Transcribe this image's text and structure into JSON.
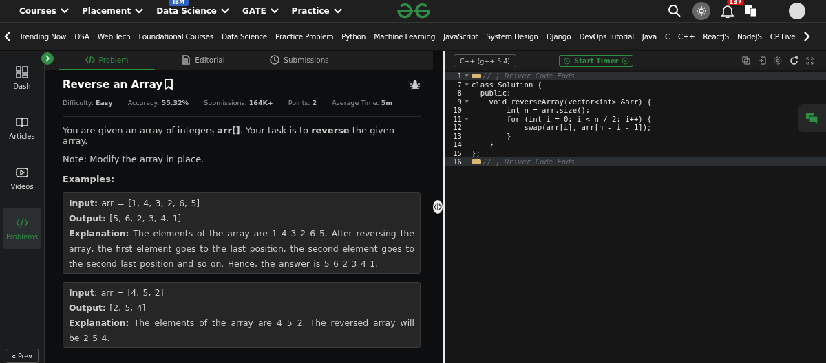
{
  "top_nav": {
    "menus": [
      {
        "label": "Courses"
      },
      {
        "label": "Placement"
      },
      {
        "label": "Data Science",
        "badge": "IBM"
      },
      {
        "label": "GATE"
      },
      {
        "label": "Practice"
      }
    ],
    "notification_count": "137"
  },
  "category_nav": [
    "Trending Now",
    "DSA",
    "Web Tech",
    "Foundational Courses",
    "Data Science",
    "Practice Problem",
    "Python",
    "Machine Learning",
    "JavaScript",
    "System Design",
    "Django",
    "DevOps Tutorial",
    "Java",
    "C",
    "C++",
    "ReactJS",
    "NodeJS",
    "CP Live"
  ],
  "sidebar": {
    "items": [
      {
        "label": "Dash",
        "selected": false
      },
      {
        "label": "Articles",
        "selected": false
      },
      {
        "label": "Videos",
        "selected": false
      },
      {
        "label": "Problems",
        "selected": true
      }
    ],
    "prev_button": "« Prev"
  },
  "tabs": [
    {
      "label": "Problem",
      "selected": true
    },
    {
      "label": "Editorial",
      "selected": false
    },
    {
      "label": "Submissions",
      "selected": false
    }
  ],
  "problem": {
    "title": "Reverse an Array",
    "meta": [
      "Difficulty: **Easy**",
      "Accuracy: **55.32%**",
      "Submissions: **164K+**",
      "Points: **2**",
      "Average Time: **5m**"
    ],
    "statement": "You are given an array of integers **arr[]**. Your task is to **reverse** the given array.",
    "note": "Note: Modify the array in place.",
    "examples_heading": "Examples:",
    "examples": [
      [
        "**Input:** arr = [1, 4, 3, 2, 6, 5]",
        "**Output:** [5, 6, 2, 3, 4, 1]",
        "**Explanation:** The elements of the array are 1 4 3 2 6 5. After reversing the array, the first element goes to the last position, the second element goes to the second last position and so on. Hence, the answer is 5 6 2 3 4 1."
      ],
      [
        "**Input**: arr = [4, 5, 2]",
        "**Output:** [2, 5, 4]",
        "**Explanation:** The elements of the array are 4 5 2. The reversed array will be 2 5 4."
      ]
    ]
  },
  "editor": {
    "language": "C++ (g++ 5.4)",
    "timer_button": "Start Timer",
    "lines": [
      {
        "number": "1",
        "foldable": true,
        "kind": "folded",
        "text": "// } Driver Code Ends"
      },
      {
        "number": "7",
        "foldable": true,
        "kind": "code",
        "text": "class Solution {"
      },
      {
        "number": "8",
        "foldable": false,
        "kind": "code",
        "text": "  public:"
      },
      {
        "number": "9",
        "foldable": true,
        "kind": "code",
        "text": "    void reverseArray(vector<int> &arr) {"
      },
      {
        "number": "10",
        "foldable": false,
        "kind": "code",
        "text": "        int n = arr.size();"
      },
      {
        "number": "11",
        "foldable": true,
        "kind": "code",
        "text": "        for (int i = 0; i < n / 2; i++) {"
      },
      {
        "number": "12",
        "foldable": false,
        "kind": "code",
        "text": "            swap(arr[i], arr[n - i - 1]);"
      },
      {
        "number": "13",
        "foldable": false,
        "kind": "code",
        "text": "        }"
      },
      {
        "number": "14",
        "foldable": false,
        "kind": "code",
        "text": "    }"
      },
      {
        "number": "15",
        "foldable": false,
        "kind": "code",
        "text": "};"
      },
      {
        "number": "16",
        "foldable": false,
        "kind": "folded",
        "text": "// } Driver Code Ends"
      }
    ]
  }
}
